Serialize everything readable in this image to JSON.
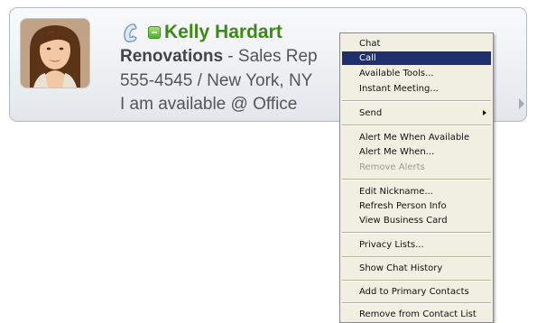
{
  "contact": {
    "name": "Kelly Hardart",
    "company": "Renovations",
    "role": " - Sales Rep",
    "phone_location": "555-4545 / New York, NY",
    "status_note": "I am available @ Office",
    "presence": "available",
    "presence_color": "#4fb12b"
  },
  "menu": {
    "highlight_color": "#1f2f6d",
    "items": {
      "chat": "Chat",
      "call": "Call",
      "available_tools": "Available Tools...",
      "instant_meeting": "Instant Meeting...",
      "send": "Send",
      "alert_when_available": "Alert Me When Available",
      "alert_when": "Alert Me When...",
      "remove_alerts": "Remove Alerts",
      "edit_nickname": "Edit Nickname...",
      "refresh_person_info": "Refresh Person Info",
      "view_business_card": "View Business Card",
      "privacy_lists": "Privacy Lists...",
      "show_chat_history": "Show Chat History",
      "add_to_primary_contacts": "Add to Primary Contacts",
      "remove_from_contact_list": "Remove from Contact List"
    },
    "highlighted": "call",
    "disabled": [
      "remove_alerts"
    ]
  },
  "icons": {
    "phone": "phone-icon",
    "presence": "presence-available-icon",
    "expand": "chevron-right-icon",
    "submenu": "submenu-arrow-icon"
  }
}
